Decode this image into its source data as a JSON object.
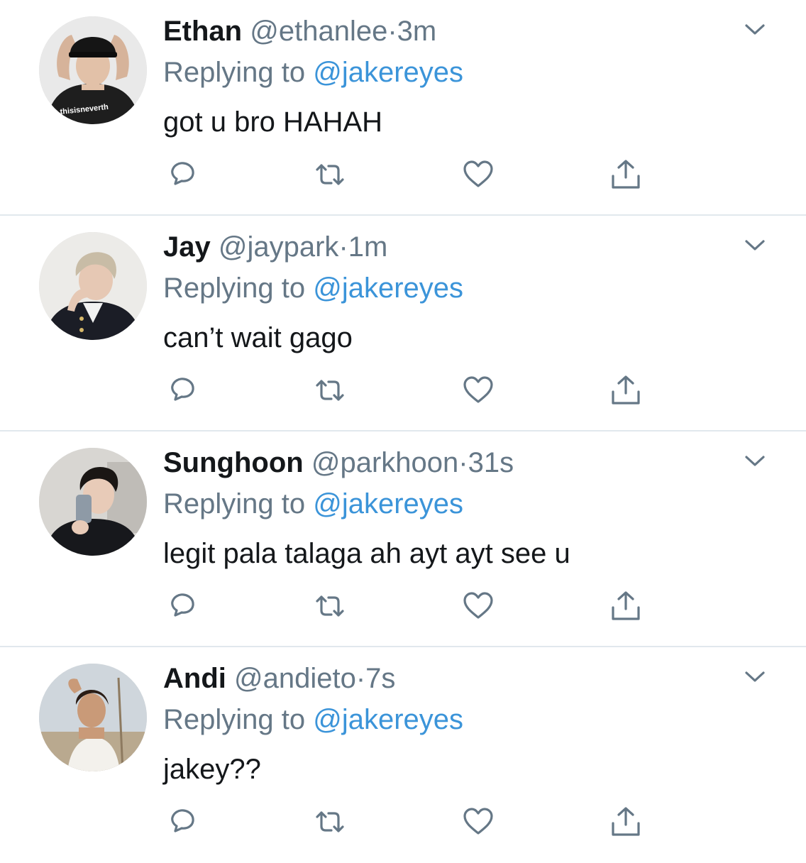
{
  "colors": {
    "name": "#14171a",
    "secondary": "#657786",
    "mention": "#3b94d9",
    "divider": "#e1e8ed"
  },
  "icons": {
    "chevron": "chevron-down-icon",
    "reply": "reply-icon",
    "retweet": "retweet-icon",
    "like": "heart-icon",
    "share": "share-icon"
  },
  "tweets": [
    {
      "name": "Ethan",
      "handle": "@ethanlee",
      "dot": "·",
      "time": "3m",
      "reply_prefix": "Replying to",
      "reply_to": "@jakereyes",
      "text": "got u bro HAHAH",
      "avatar_shirt_text": "thisisneverth"
    },
    {
      "name": "Jay",
      "handle": "@jaypark",
      "dot": "·",
      "time": "1m",
      "reply_prefix": "Replying to",
      "reply_to": "@jakereyes",
      "text": "can’t wait gago"
    },
    {
      "name": "Sunghoon",
      "handle": "@parkhoon",
      "dot": "·",
      "time": "31s",
      "reply_prefix": "Replying to",
      "reply_to": "@jakereyes",
      "text": "legit pala talaga ah ayt ayt see u"
    },
    {
      "name": "Andi",
      "handle": "@andieto",
      "dot": "·",
      "time": "7s",
      "reply_prefix": "Replying to",
      "reply_to": "@jakereyes",
      "text": "jakey??"
    }
  ]
}
